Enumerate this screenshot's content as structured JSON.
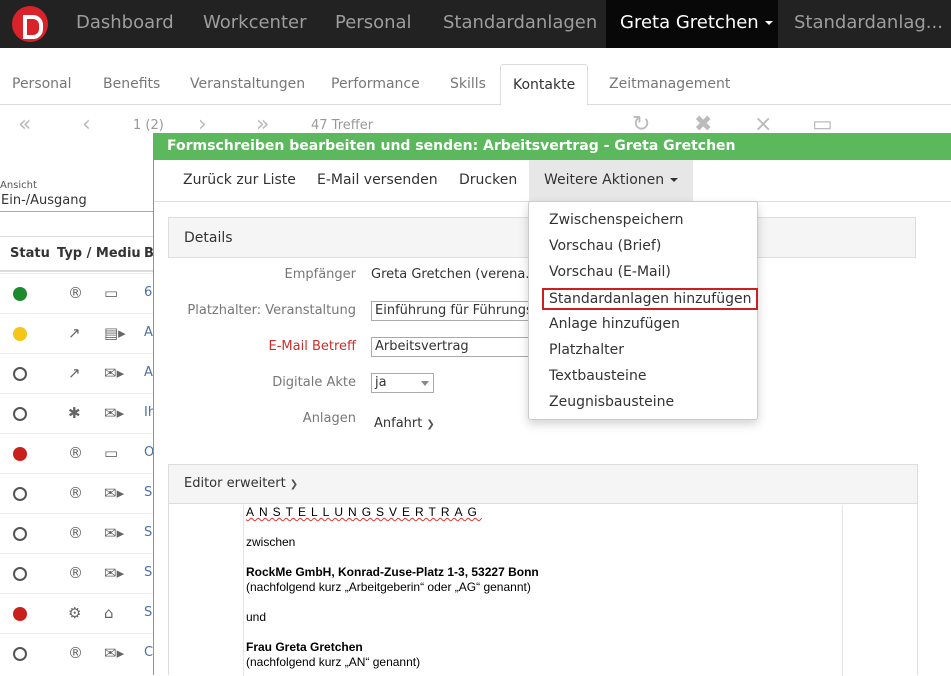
{
  "topbar": {
    "items": [
      "Dashboard",
      "Workcenter",
      "Personal",
      "Standardanlagen",
      "Greta Gretchen",
      "Standardanlag..."
    ]
  },
  "subtabs": [
    "Personal",
    "Benefits",
    "Veranstaltungen",
    "Performance",
    "Skills",
    "Kontakte",
    "Zeitmanagement"
  ],
  "pager": {
    "page": "1 (2)",
    "count": "47 Treffer"
  },
  "list": {
    "view_label": "Ansicht",
    "view_value": "Ein-/Ausgang",
    "headers": [
      "Statu",
      "Typ / Mediu",
      "B"
    ],
    "rows": [
      {
        "status": "#1e8a2e",
        "type": "registered-icon",
        "medium": "laptop-icon",
        "text": "6"
      },
      {
        "status": "#f5c518",
        "type": "chart-icon",
        "medium": "document-icon",
        "text": "A"
      },
      {
        "status": "outline",
        "type": "chart-icon",
        "medium": "envelope-icon",
        "text": "A"
      },
      {
        "status": "outline",
        "type": "asterisk-icon",
        "medium": "envelope-icon",
        "text": "Ih"
      },
      {
        "status": "#c9211e",
        "type": "registered-icon",
        "medium": "laptop-icon",
        "text": "O"
      },
      {
        "status": "outline",
        "type": "registered-icon",
        "medium": "envelope-icon",
        "text": "S"
      },
      {
        "status": "outline",
        "type": "registered-icon",
        "medium": "envelope-icon",
        "text": "S"
      },
      {
        "status": "outline",
        "type": "registered-icon",
        "medium": "envelope-icon",
        "text": "S"
      },
      {
        "status": "#c9211e",
        "type": "gears-icon",
        "medium": "bank-icon",
        "text": "S"
      },
      {
        "status": "outline",
        "type": "registered-icon",
        "medium": "envelope-icon",
        "text": "C"
      }
    ]
  },
  "modal": {
    "title": "Formschreiben bearbeiten und senden: Arbeitsvertrag - Greta Gretchen",
    "nav": [
      "Zurück zur Liste",
      "E-Mail versenden",
      "Drucken",
      "Weitere Aktionen"
    ],
    "details_title": "Details",
    "fields": {
      "recipient_label": "Empfänger",
      "recipient_value": "Greta Gretchen (verena.ro",
      "placeholder_label": "Platzhalter: Veranstaltung",
      "placeholder_value": "Einführung für Führungsk",
      "subject_label": "E-Mail Betreff",
      "subject_value": "Arbeitsvertrag",
      "digital_label": "Digitale Akte",
      "digital_value": "ja",
      "attachments_label": "Anlagen",
      "attachments_value": "Anfahrt"
    },
    "editor_title": "Editor erweitert",
    "document": {
      "heading": "ANSTELLUNGSVERTRAG",
      "l1": "zwischen",
      "l2": "RockMe GmbH, Konrad-Zuse-Platz 1-3, 53227 Bonn",
      "l3": "(nachfolgend kurz „Arbeitgeberin“ oder „AG“ genannt)",
      "l4": "und",
      "l5": "Frau Greta Gretchen",
      "l6": "(nachfolgend kurz „AN“ genannt)"
    }
  },
  "dropdown": {
    "items": [
      "Zwischenspeichern",
      "Vorschau (Brief)",
      "Vorschau (E-Mail)",
      "Standardanlagen hinzufügen",
      "Anlage hinzufügen",
      "Platzhalter",
      "Textbausteine",
      "Zeugnisbausteine"
    ]
  },
  "colors": {
    "accent_green": "#5cb85c",
    "highlight_red": "#cc1f1f",
    "required_red": "#c9302c"
  }
}
